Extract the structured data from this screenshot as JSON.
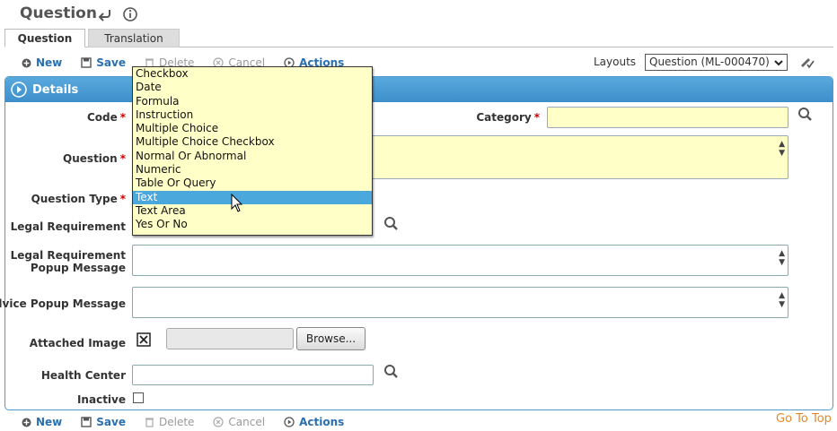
{
  "page": {
    "title": "Question"
  },
  "tabs": [
    {
      "label": "Question"
    },
    {
      "label": "Translation"
    }
  ],
  "toolbar": {
    "new": "New",
    "save": "Save",
    "delete": "Delete",
    "cancel": "Cancel",
    "actions": "Actions"
  },
  "layouts": {
    "label": "Layouts",
    "selected": "Question (ML-000470)"
  },
  "panel": {
    "title": "Details"
  },
  "fields": {
    "code": {
      "label": "Code",
      "required": "*"
    },
    "category": {
      "label": "Category",
      "required": "*"
    },
    "question": {
      "label": "Question",
      "required": "*"
    },
    "question_type": {
      "label": "Question Type",
      "required": "*"
    },
    "legal_requirement": {
      "label": "Legal Requirement"
    },
    "legal_popup_line1": "Legal Requirement",
    "legal_popup_line2": "Popup Message",
    "advice_popup": {
      "label": "Advice Popup Message"
    },
    "attached_image": {
      "label": "Attached Image",
      "browse": "Browse..."
    },
    "health_center": {
      "label": "Health Center"
    },
    "inactive": {
      "label": "Inactive"
    }
  },
  "question_type_options": [
    "Checkbox",
    "Date",
    "Formula",
    "Instruction",
    "Multiple Choice",
    "Multiple Choice Checkbox",
    "Normal Or Abnormal",
    "Numeric",
    "Table Or Query",
    "Text",
    "Text Area",
    "Yes Or No"
  ],
  "question_type_highlighted": "Text",
  "footer": {
    "go_to_top": "Go To Top"
  },
  "colors": {
    "accent": "#4a9bd0",
    "required_bg": "#ffffc8",
    "link": "#2a6fb0",
    "go_top": "#e08a2e"
  }
}
